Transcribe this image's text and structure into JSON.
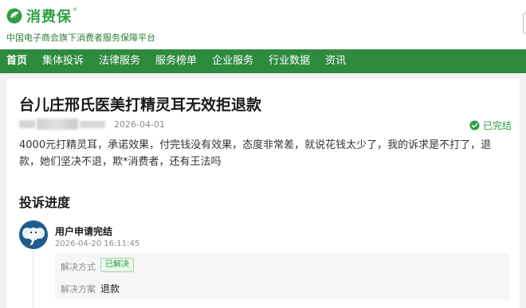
{
  "brand": {
    "name": "消费保",
    "registered_mark": "®",
    "tagline": "中国电子商会旗下消费者服务保障平台",
    "color": "#2ea043"
  },
  "nav": {
    "bg_color": "#2e8b3e",
    "items": [
      {
        "label": "首页",
        "active": true
      },
      {
        "label": "集体投诉"
      },
      {
        "label": "法律服务"
      },
      {
        "label": "服务榜单"
      },
      {
        "label": "企业服务"
      },
      {
        "label": "行业数据"
      },
      {
        "label": "资讯"
      }
    ]
  },
  "complaint": {
    "title": "台儿庄邢氏医美打精灵耳无效拒退款",
    "date": "2026-04-01",
    "status": "已完结",
    "status_icon": "check-circle-icon",
    "body": "4000元打精灵耳，承诺效果，付完钱没有效果，态度非常差，就说花钱太少了，我的诉求是不打了，退款，她们坚决不退，欺*消费者，还有王法吗"
  },
  "progress": {
    "section_title": "投诉进度",
    "steps": [
      {
        "avatar_icon": "elephant-mascot-icon",
        "title": "用户申请完结",
        "time": "2026-04-20 16:11:45",
        "fields": [
          {
            "label": "解决方式",
            "value": "已解决",
            "style": "tag"
          },
          {
            "label": "解决方案",
            "value": "退款"
          }
        ]
      }
    ]
  }
}
